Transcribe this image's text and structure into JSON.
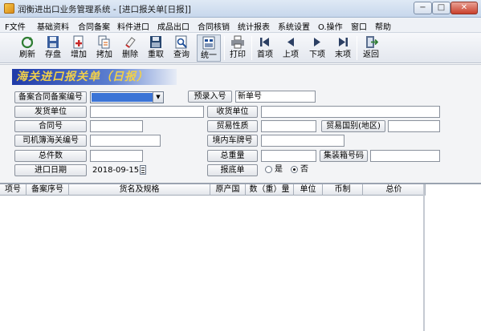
{
  "window": {
    "title": "润衡进出口业务管理系统 - [进口报关单[日报]]",
    "controls": {
      "min": "−",
      "max": "□",
      "close": "✕"
    }
  },
  "menu": [
    "F文件",
    "基础资料",
    "合同备案",
    "料件进口",
    "成品出口",
    "合同核销",
    "统计报表",
    "系统设置",
    "O.操作",
    "窗口",
    "帮助"
  ],
  "toolbar": [
    {
      "label": "刷新",
      "icon": "refresh-icon"
    },
    {
      "label": "存盘",
      "icon": "save-icon"
    },
    {
      "label": "增加",
      "icon": "add-icon"
    },
    {
      "label": "拷加",
      "icon": "copy-add-icon"
    },
    {
      "label": "删除",
      "icon": "delete-icon"
    },
    {
      "label": "重取",
      "icon": "reload-icon"
    },
    {
      "label": "查询",
      "icon": "query-icon"
    },
    {
      "label": "统一",
      "icon": "unify-icon"
    },
    {
      "label": "打印",
      "icon": "print-icon"
    },
    {
      "label": "首项",
      "icon": "first-icon"
    },
    {
      "label": "上项",
      "icon": "prev-icon"
    },
    {
      "label": "下项",
      "icon": "next-icon"
    },
    {
      "label": "末项",
      "icon": "last-icon"
    },
    {
      "label": "返回",
      "icon": "exit-icon"
    }
  ],
  "form": {
    "heading": "海关进口报关单（日报）",
    "labels": {
      "filing_no": "备案合同备案编号",
      "pre_entry": "预录入号",
      "shipper": "发货单位",
      "consignee": "收货单位",
      "contract_no": "合同号",
      "trade_nature": "贸易性质",
      "trade_country": "贸易国别(地区)",
      "driver_customs_no": "司机簿海关编号",
      "domestic_plate": "境内车牌号",
      "total_pieces": "总件数",
      "gross_weight": "总重量",
      "container_no": "集装箱号码",
      "import_date": "进口日期",
      "declared": "报底单"
    },
    "values": {
      "pre_entry": "新单号",
      "import_date": "2018-09-15"
    },
    "radio": {
      "yes": "是",
      "no": "否",
      "selected": "no"
    }
  },
  "grid": {
    "columns": [
      "项号",
      "备案序号",
      "货名及规格",
      "原产国",
      "数（重）量",
      "单位",
      "币制",
      "总价"
    ]
  }
}
